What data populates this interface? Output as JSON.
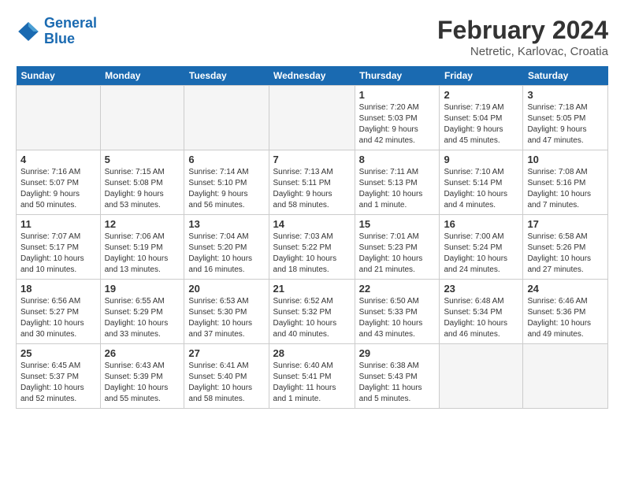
{
  "header": {
    "logo_line1": "General",
    "logo_line2": "Blue",
    "month_year": "February 2024",
    "location": "Netretic, Karlovac, Croatia"
  },
  "weekdays": [
    "Sunday",
    "Monday",
    "Tuesday",
    "Wednesday",
    "Thursday",
    "Friday",
    "Saturday"
  ],
  "weeks": [
    [
      {
        "day": "",
        "info": ""
      },
      {
        "day": "",
        "info": ""
      },
      {
        "day": "",
        "info": ""
      },
      {
        "day": "",
        "info": ""
      },
      {
        "day": "1",
        "info": "Sunrise: 7:20 AM\nSunset: 5:03 PM\nDaylight: 9 hours\nand 42 minutes."
      },
      {
        "day": "2",
        "info": "Sunrise: 7:19 AM\nSunset: 5:04 PM\nDaylight: 9 hours\nand 45 minutes."
      },
      {
        "day": "3",
        "info": "Sunrise: 7:18 AM\nSunset: 5:05 PM\nDaylight: 9 hours\nand 47 minutes."
      }
    ],
    [
      {
        "day": "4",
        "info": "Sunrise: 7:16 AM\nSunset: 5:07 PM\nDaylight: 9 hours\nand 50 minutes."
      },
      {
        "day": "5",
        "info": "Sunrise: 7:15 AM\nSunset: 5:08 PM\nDaylight: 9 hours\nand 53 minutes."
      },
      {
        "day": "6",
        "info": "Sunrise: 7:14 AM\nSunset: 5:10 PM\nDaylight: 9 hours\nand 56 minutes."
      },
      {
        "day": "7",
        "info": "Sunrise: 7:13 AM\nSunset: 5:11 PM\nDaylight: 9 hours\nand 58 minutes."
      },
      {
        "day": "8",
        "info": "Sunrise: 7:11 AM\nSunset: 5:13 PM\nDaylight: 10 hours\nand 1 minute."
      },
      {
        "day": "9",
        "info": "Sunrise: 7:10 AM\nSunset: 5:14 PM\nDaylight: 10 hours\nand 4 minutes."
      },
      {
        "day": "10",
        "info": "Sunrise: 7:08 AM\nSunset: 5:16 PM\nDaylight: 10 hours\nand 7 minutes."
      }
    ],
    [
      {
        "day": "11",
        "info": "Sunrise: 7:07 AM\nSunset: 5:17 PM\nDaylight: 10 hours\nand 10 minutes."
      },
      {
        "day": "12",
        "info": "Sunrise: 7:06 AM\nSunset: 5:19 PM\nDaylight: 10 hours\nand 13 minutes."
      },
      {
        "day": "13",
        "info": "Sunrise: 7:04 AM\nSunset: 5:20 PM\nDaylight: 10 hours\nand 16 minutes."
      },
      {
        "day": "14",
        "info": "Sunrise: 7:03 AM\nSunset: 5:22 PM\nDaylight: 10 hours\nand 18 minutes."
      },
      {
        "day": "15",
        "info": "Sunrise: 7:01 AM\nSunset: 5:23 PM\nDaylight: 10 hours\nand 21 minutes."
      },
      {
        "day": "16",
        "info": "Sunrise: 7:00 AM\nSunset: 5:24 PM\nDaylight: 10 hours\nand 24 minutes."
      },
      {
        "day": "17",
        "info": "Sunrise: 6:58 AM\nSunset: 5:26 PM\nDaylight: 10 hours\nand 27 minutes."
      }
    ],
    [
      {
        "day": "18",
        "info": "Sunrise: 6:56 AM\nSunset: 5:27 PM\nDaylight: 10 hours\nand 30 minutes."
      },
      {
        "day": "19",
        "info": "Sunrise: 6:55 AM\nSunset: 5:29 PM\nDaylight: 10 hours\nand 33 minutes."
      },
      {
        "day": "20",
        "info": "Sunrise: 6:53 AM\nSunset: 5:30 PM\nDaylight: 10 hours\nand 37 minutes."
      },
      {
        "day": "21",
        "info": "Sunrise: 6:52 AM\nSunset: 5:32 PM\nDaylight: 10 hours\nand 40 minutes."
      },
      {
        "day": "22",
        "info": "Sunrise: 6:50 AM\nSunset: 5:33 PM\nDaylight: 10 hours\nand 43 minutes."
      },
      {
        "day": "23",
        "info": "Sunrise: 6:48 AM\nSunset: 5:34 PM\nDaylight: 10 hours\nand 46 minutes."
      },
      {
        "day": "24",
        "info": "Sunrise: 6:46 AM\nSunset: 5:36 PM\nDaylight: 10 hours\nand 49 minutes."
      }
    ],
    [
      {
        "day": "25",
        "info": "Sunrise: 6:45 AM\nSunset: 5:37 PM\nDaylight: 10 hours\nand 52 minutes."
      },
      {
        "day": "26",
        "info": "Sunrise: 6:43 AM\nSunset: 5:39 PM\nDaylight: 10 hours\nand 55 minutes."
      },
      {
        "day": "27",
        "info": "Sunrise: 6:41 AM\nSunset: 5:40 PM\nDaylight: 10 hours\nand 58 minutes."
      },
      {
        "day": "28",
        "info": "Sunrise: 6:40 AM\nSunset: 5:41 PM\nDaylight: 11 hours\nand 1 minute."
      },
      {
        "day": "29",
        "info": "Sunrise: 6:38 AM\nSunset: 5:43 PM\nDaylight: 11 hours\nand 5 minutes."
      },
      {
        "day": "",
        "info": ""
      },
      {
        "day": "",
        "info": ""
      }
    ]
  ]
}
